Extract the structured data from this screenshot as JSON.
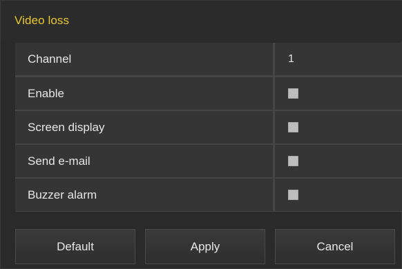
{
  "dialog": {
    "title": "Video loss"
  },
  "settings": {
    "channel": {
      "label": "Channel",
      "value": "1"
    },
    "enable": {
      "label": "Enable",
      "checked": false
    },
    "screen_display": {
      "label": "Screen display",
      "checked": false
    },
    "send_email": {
      "label": "Send e-mail",
      "checked": false
    },
    "buzzer_alarm": {
      "label": "Buzzer alarm",
      "checked": false
    }
  },
  "buttons": {
    "default_label": "Default",
    "apply_label": "Apply",
    "cancel_label": "Cancel"
  },
  "colors": {
    "title_accent": "#e8c830",
    "background": "#2b2b2b",
    "cell_background": "#353535",
    "checkbox_fill": "#bdbdbd"
  }
}
